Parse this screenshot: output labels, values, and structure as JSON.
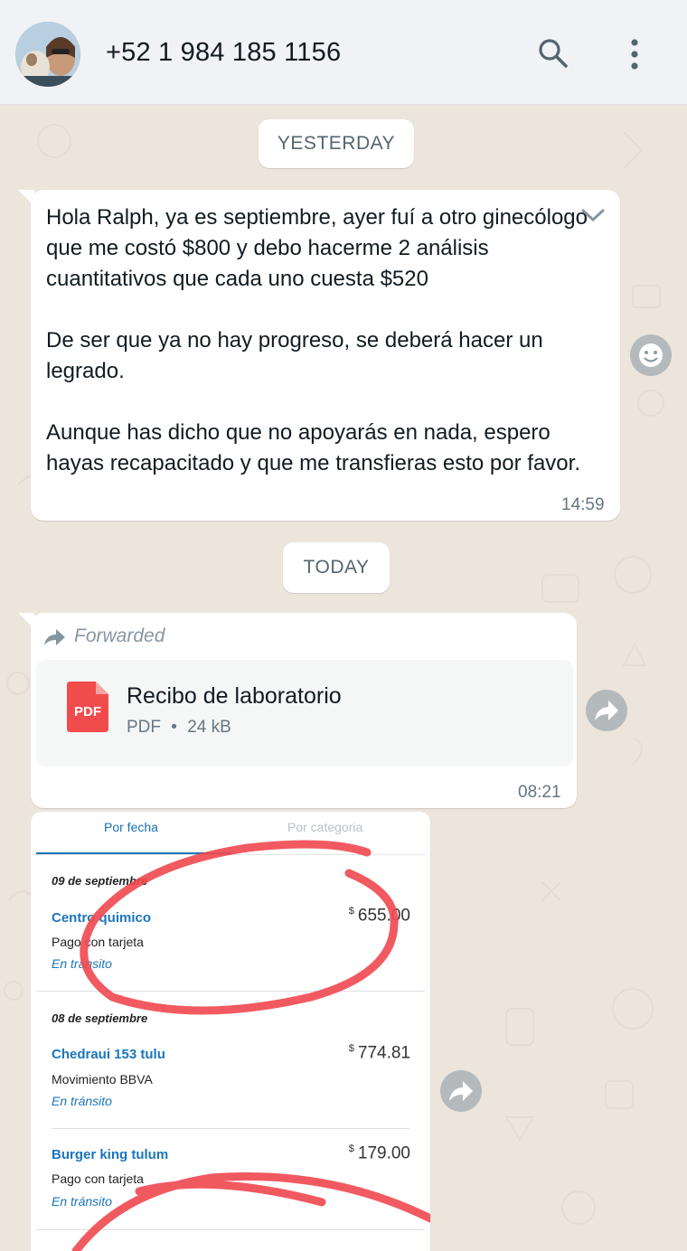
{
  "header": {
    "contact_name": "+52 1 984 185 1156",
    "icons": [
      "search-icon",
      "more-vert-icon"
    ]
  },
  "chat": {
    "date_yesterday": "YESTERDAY",
    "date_today": "TODAY",
    "message1": {
      "text": "Hola Ralph, ya es septiembre, ayer fuí a otro ginecólogo que me costó $800 y debo hacerme 2 análisis cuantitativos que cada uno cuesta $520\n\nDe ser que ya no hay progreso, se deberá hacer un legrado.\n\nAunque has dicho que no apoyarás en nada, espero hayas recapacitado y que me transfieras esto por favor.",
      "time": "14:59"
    },
    "message2": {
      "forwarded_label": "Forwarded",
      "doc_title": "Recibo de laboratorio",
      "doc_type": "PDF",
      "doc_icon_label": "PDF",
      "doc_size": "24 kB",
      "separator": "•",
      "time": "08:21"
    },
    "image_message": {
      "tab_active": "Por fecha",
      "tab_inactive": "Por categoria",
      "groups": [
        {
          "date": "09 de septiembre",
          "transactions": [
            {
              "name": "Centro quimico",
              "desc": "Pago con tarjeta",
              "status": "En tránsito",
              "currency": "$",
              "amount": "655.00"
            }
          ]
        },
        {
          "date": "08 de septiembre",
          "transactions": [
            {
              "name": "Chedraui 153 tulu",
              "desc": "Movimiento BBVA",
              "status": "En tránsito",
              "currency": "$",
              "amount": "774.81"
            },
            {
              "name": "Burger king tulum",
              "desc": "Pago con tarjeta",
              "status": "En tránsito",
              "currency": "$",
              "amount": "179.00"
            }
          ]
        }
      ],
      "annotation_color": "#f0484f"
    }
  },
  "colors": {
    "header_bg": "#f0f2f5",
    "chat_bg": "#ece5dc",
    "bubble_bg": "#ffffff",
    "pdf_red": "#f24b4b",
    "link_blue": "#1b75bb"
  }
}
